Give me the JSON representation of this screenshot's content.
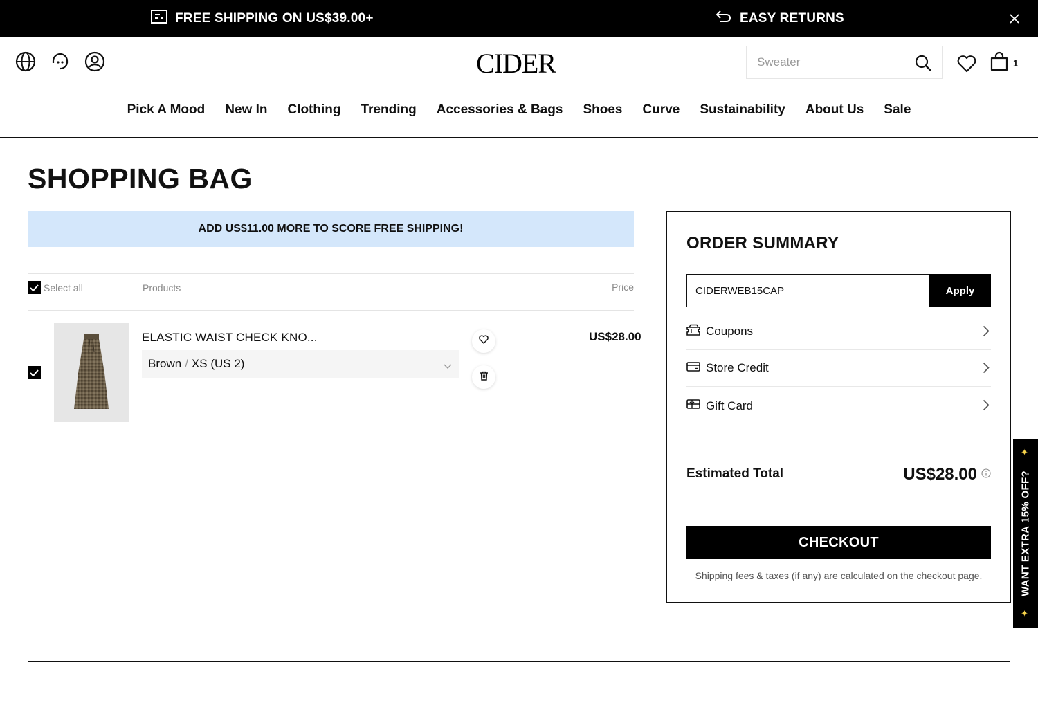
{
  "promo": {
    "left_text": "FREE SHIPPING ON US$39.00+",
    "right_text": "EASY RETURNS"
  },
  "header": {
    "logo": "CIDER",
    "search_placeholder": "Sweater",
    "bag_count": "1"
  },
  "nav": {
    "items": [
      "Pick A Mood",
      "New In",
      "Clothing",
      "Trending",
      "Accessories & Bags",
      "Shoes",
      "Curve",
      "Sustainability",
      "About Us",
      "Sale"
    ]
  },
  "page": {
    "title": "SHOPPING BAG",
    "shipping_banner": "ADD US$11.00 MORE TO SCORE FREE SHIPPING!"
  },
  "list": {
    "select_all": "Select all",
    "col_products": "Products",
    "col_price": "Price"
  },
  "item": {
    "name": "ELASTIC WAIST CHECK KNO...",
    "color": "Brown",
    "separator": "/",
    "size": "XS (US 2)",
    "price": "US$28.00"
  },
  "summary": {
    "title": "ORDER SUMMARY",
    "coupon_code": "CIDERWEB15CAP",
    "apply_label": "Apply",
    "rows": [
      "Coupons",
      "Store Credit",
      "Gift Card"
    ],
    "estimated_label": "Estimated Total",
    "estimated_value": "US$28.00",
    "checkout_label": "CHECKOUT",
    "note": "Shipping fees & taxes (if any) are calculated on the checkout page."
  },
  "side_tab": {
    "text": "WANT EXTRA 15% OFF?"
  },
  "colors": {
    "banner_bg": "#d4e7fb",
    "black": "#000000",
    "accent_spark": "#f5d24a"
  }
}
